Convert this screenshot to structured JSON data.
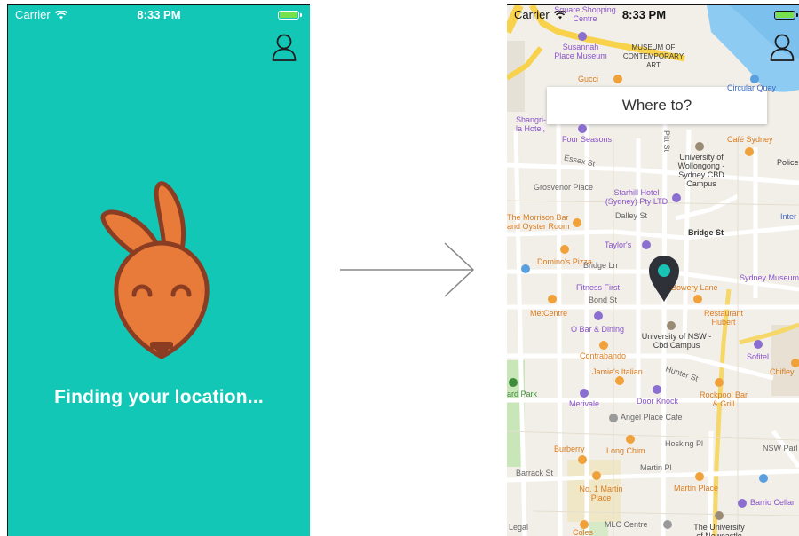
{
  "left_screen": {
    "status": {
      "carrier": "Carrier",
      "time": "8:33 PM"
    },
    "message": "Finding your location..."
  },
  "right_screen": {
    "status": {
      "carrier": "Carrier",
      "time": "8:33 PM"
    },
    "search_placeholder": "Where to?",
    "map_labels": [
      "Square Shopping Centre",
      "Susannah Place Museum",
      "MUSEUM OF CONTEMPORARY ART",
      "Gucci",
      "Shangri-la Hotel, Sydney",
      "Four Seasons",
      "Café Sydney",
      "University of Wollongong - Sydney CBD Campus",
      "Grosvenor Place",
      "Starhill Hotel (Sydney) Pty LTD",
      "The Morrison Bar and Oyster Room",
      "Taylor's",
      "Domino's Pizza",
      "Bridge St",
      "Sydney Museum",
      "Fitness First",
      "Bowery Lane",
      "Bond St",
      "MetCentre",
      "Restaurant Hubert",
      "O Bar & Dining",
      "University of NSW - Cbd Campus",
      "Contrabando",
      "Sofitel",
      "Chifley",
      "Jamie's Italian",
      "Hunter St",
      "Merivale",
      "Door Knock",
      "Rockpool Bar & Grill",
      "Angel Place Cafe",
      "Burberry",
      "Long Chim",
      "Hosking Pl",
      "Martin Pl",
      "NSW Parl",
      "No. 1 Martin Place",
      "Martin Place",
      "Barrio Cellar",
      "Coles",
      "MLC Centre",
      "The University of Newcastle",
      "Legal",
      "Barrack St",
      "Essex St",
      "Dalley St",
      "Bridge Ln",
      "Pitt St",
      "Police",
      "Inter",
      "ard Park",
      "Circular Quay"
    ]
  },
  "colors": {
    "teal": "#13c7b7",
    "mascot_orange": "#e87a3a",
    "mascot_outline": "#8a3d23",
    "pin_dark": "#2f3138",
    "pin_center": "#19c4b4"
  },
  "icons": {
    "profile": "user-outline-icon",
    "wifi": "wifi-icon",
    "battery": "battery-icon",
    "arrow": "arrow-right-icon",
    "pin": "map-pin-icon",
    "mascot": "kangaroo-mascot-icon"
  }
}
